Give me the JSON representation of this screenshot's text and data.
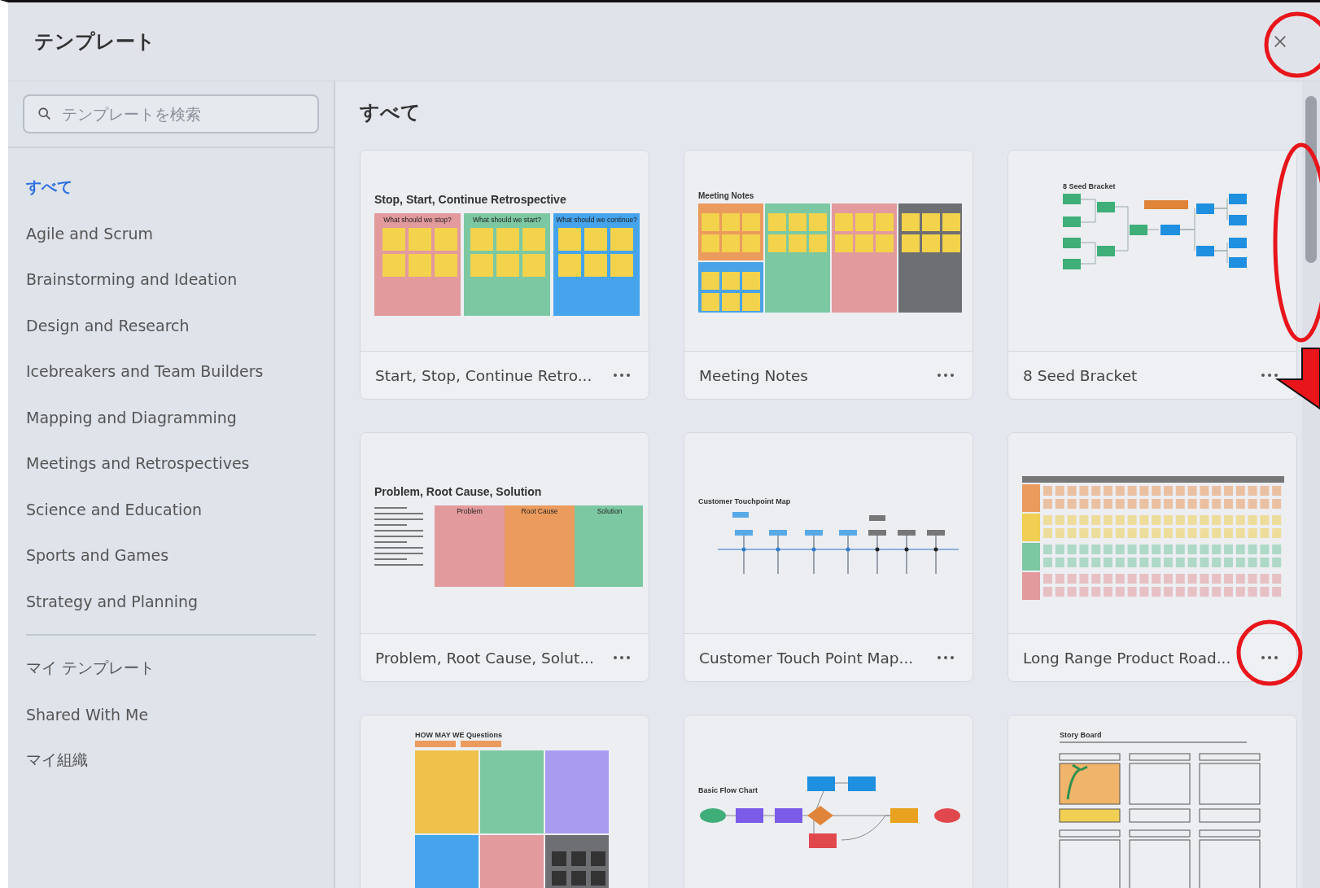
{
  "dialog": {
    "title": "テンプレート"
  },
  "search": {
    "placeholder": "テンプレートを検索"
  },
  "sidebar": {
    "categories": [
      {
        "label": "すべて",
        "selected": true
      },
      {
        "label": "Agile and Scrum",
        "selected": false
      },
      {
        "label": "Brainstorming and Ideation",
        "selected": false
      },
      {
        "label": "Design and Research",
        "selected": false
      },
      {
        "label": "Icebreakers and Team Builders",
        "selected": false
      },
      {
        "label": "Mapping and Diagramming",
        "selected": false
      },
      {
        "label": "Meetings and Retrospectives",
        "selected": false
      },
      {
        "label": "Science and Education",
        "selected": false
      },
      {
        "label": "Sports and Games",
        "selected": false
      },
      {
        "label": "Strategy and Planning",
        "selected": false
      }
    ],
    "personal": [
      {
        "label": "マイ テンプレート",
        "selected": false
      },
      {
        "label": "Shared With Me",
        "selected": false
      },
      {
        "label": "マイ組織",
        "selected": false
      }
    ]
  },
  "section": {
    "heading": "すべて"
  },
  "templates": [
    {
      "name": "Start, Stop, Continue Retro...",
      "preview": {
        "kind": "retro",
        "title": "Stop, Start, Continue Retrospective",
        "labels": [
          "What should we stop?",
          "What should we start?",
          "What should we continue?"
        ]
      }
    },
    {
      "name": "Meeting Notes",
      "preview": {
        "kind": "meeting",
        "title": "Meeting Notes"
      }
    },
    {
      "name": "8 Seed Bracket",
      "preview": {
        "kind": "bracket",
        "title": "8 Seed Bracket"
      }
    },
    {
      "name": "Problem, Root Cause, Solut...",
      "preview": {
        "kind": "problem",
        "title": "Problem, Root Cause, Solution",
        "labels": [
          "Problem",
          "Root Cause",
          "Solution"
        ]
      }
    },
    {
      "name": "Customer Touch Point Map...",
      "preview": {
        "kind": "touchpoint",
        "title": "Customer Touchpoint Map"
      }
    },
    {
      "name": "Long Range Product Road...",
      "preview": {
        "kind": "roadmap"
      }
    },
    {
      "preview": {
        "kind": "hmw",
        "title": "HOW MAY WE Questions"
      }
    },
    {
      "preview": {
        "kind": "flow",
        "title": "Basic Flow Chart"
      }
    },
    {
      "preview": {
        "kind": "storyboard",
        "title": "Story Board"
      }
    }
  ]
}
